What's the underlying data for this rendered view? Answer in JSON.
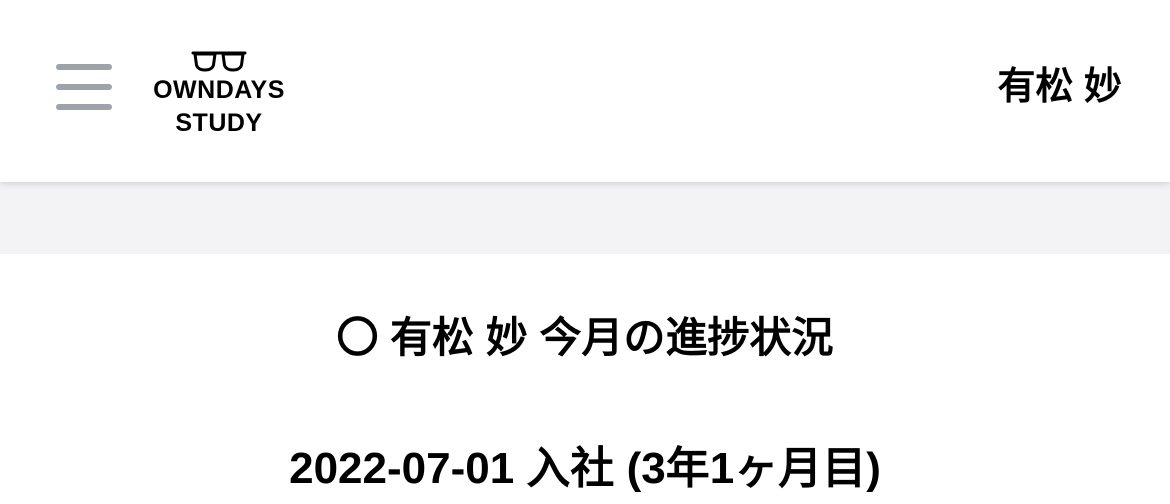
{
  "header": {
    "menu_icon": "hamburger-menu-icon",
    "logo": {
      "icon": "glasses-icon",
      "line1": "OWNDAYS",
      "line2": "STUDY"
    },
    "user_name": "有松 妙"
  },
  "main": {
    "section_title": "〇 有松 妙 今月の進捗状況",
    "join_info": "2022-07-01 入社 (3年1ヶ月目)"
  },
  "colors": {
    "menu_icon": "#9ea3aa",
    "band_background": "#f3f3f5",
    "text": "#000000"
  }
}
